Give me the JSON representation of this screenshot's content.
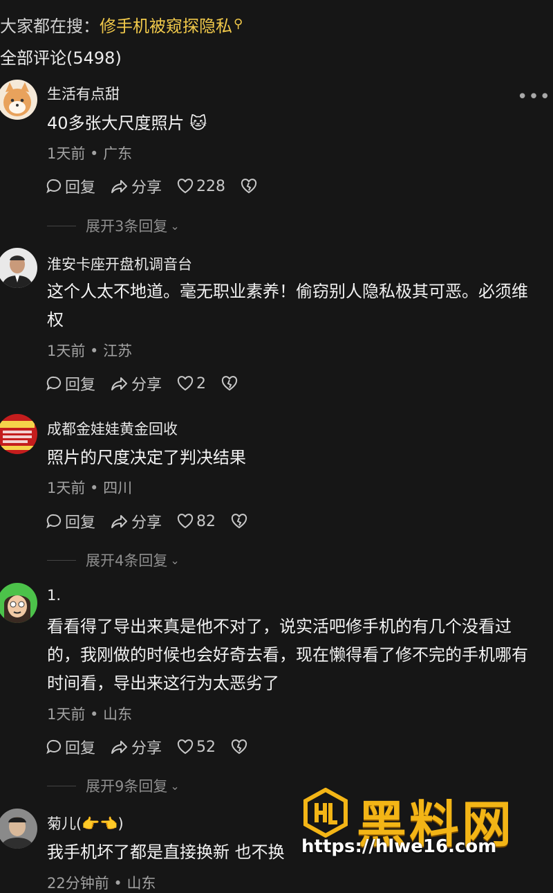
{
  "header": {
    "search_prefix": "大家都在搜：",
    "search_keyword": "修手机被窥探隐私",
    "total_comments": "全部评论(5498)"
  },
  "actions": {
    "reply": "回复",
    "share": "分享"
  },
  "comments": [
    {
      "user": "生活有点甜",
      "text": "40多张大尺度照片 🐱",
      "time": "1天前",
      "location": "广东",
      "likes": "228",
      "expand": "展开3条回复"
    },
    {
      "user": "淮安卡座开盘机调音台",
      "text": "这个人太不地道。毫无职业素养！偷窃别人隐私极其可恶。必须维权",
      "time": "1天前",
      "location": "江苏",
      "likes": "2"
    },
    {
      "user": "成都金娃娃黄金回收",
      "text": "照片的尺度决定了判决结果",
      "time": "1天前",
      "location": "四川",
      "likes": "82",
      "expand": "展开4条回复"
    },
    {
      "user": "1.",
      "text": "看看得了导出来真是他不对了，说实活吧修手机的有几个没看过的，我刚做的时候也会好奇去看，现在懒得看了修不完的手机哪有时间看，导出来这行为太恶劣了",
      "time": "1天前",
      "location": "山东",
      "likes": "52",
      "expand": "展开9条回复"
    },
    {
      "user": "菊儿(👉👈)",
      "text": "我手机坏了都是直接换新 也不换",
      "time": "22分钟前",
      "location": "山东"
    }
  ],
  "watermark": {
    "title": "黑料网",
    "url": "https://hlwe16.com"
  },
  "colors": {
    "background": "#161616",
    "keyword": "#f0c84a",
    "watermark": "#f3b516"
  }
}
